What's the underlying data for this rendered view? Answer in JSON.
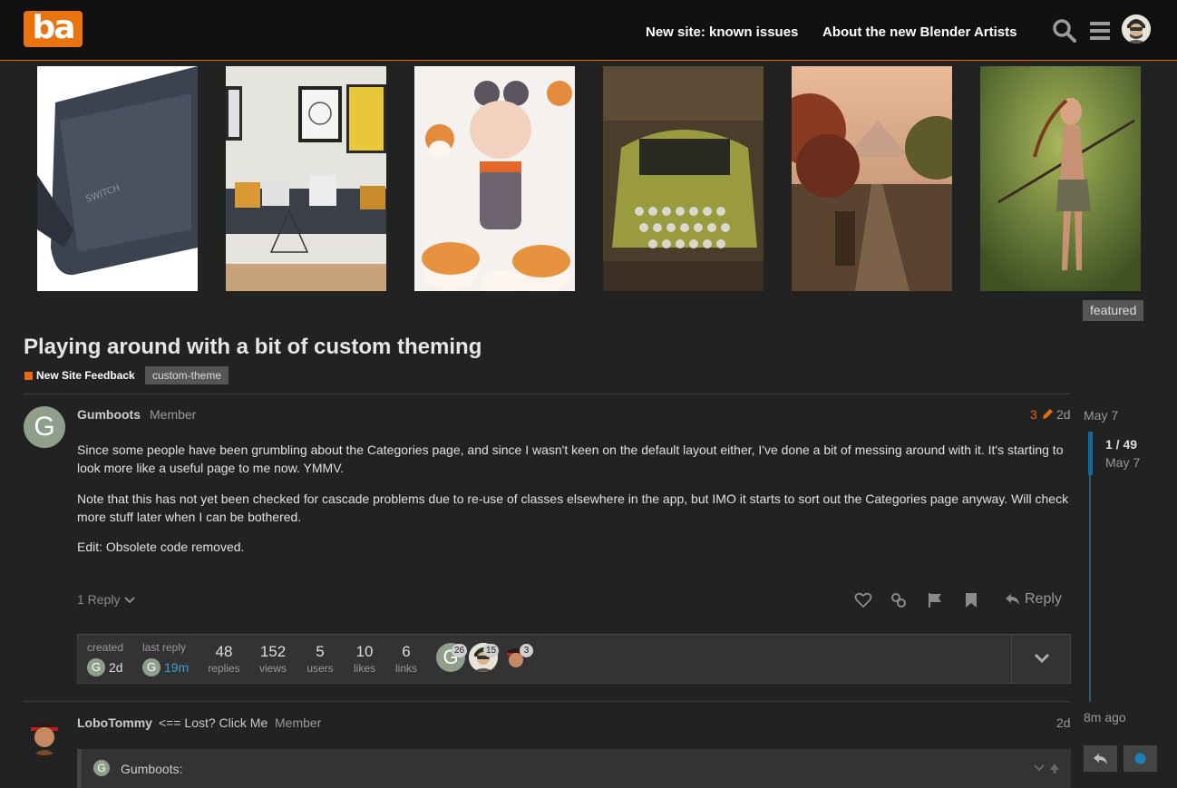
{
  "header": {
    "logo_text": "ba",
    "nav": [
      "New site: known issues",
      "About the new Blender Artists"
    ]
  },
  "featured": {
    "tag": "featured",
    "images": [
      {
        "icon": "console-image"
      },
      {
        "icon": "interior-image"
      },
      {
        "icon": "character-image"
      },
      {
        "icon": "typewriter-image"
      },
      {
        "icon": "landscape-image"
      },
      {
        "icon": "warrior-image"
      }
    ]
  },
  "topic": {
    "title": "Playing around with a bit of custom theming",
    "category": "New Site Feedback",
    "category_color": "#e86a12",
    "tag": "custom-theme"
  },
  "post": {
    "avatar_letter": "G",
    "username": "Gumboots",
    "role": "Member",
    "edit_count": "3",
    "age": "2d",
    "paragraphs": [
      "Since some people have been grumbling about the Categories page, and since I wasn't keen on the default layout either, I've done a bit of messing around with it. It's starting to look more like a useful page to me now. YMMV.",
      "Note that this has not yet been checked for cascade problems due to re-use of classes elsewhere in the app, but IMO it starts to sort out the Categories page anyway. Will check more stuff later when I can be bothered.",
      "Edit: Obsolete code removed."
    ],
    "replies_toggle": "1 Reply",
    "reply_label": "Reply"
  },
  "topic_map": {
    "created_label": "created",
    "created_value": "2d",
    "last_reply_label": "last reply",
    "last_reply_value": "19m",
    "stats": [
      {
        "value": "48",
        "label": "replies"
      },
      {
        "value": "152",
        "label": "views"
      },
      {
        "value": "5",
        "label": "users"
      },
      {
        "value": "10",
        "label": "likes"
      },
      {
        "value": "6",
        "label": "links"
      }
    ],
    "participants": [
      {
        "letter": "G",
        "count": "26"
      },
      {
        "count": "15"
      },
      {
        "count": "3"
      }
    ]
  },
  "timeline": {
    "top_date": "May 7",
    "position": "1 / 49",
    "position_date": "May 7",
    "bottom_date": "8m ago"
  },
  "post2": {
    "username": "LoboTommy",
    "title": "<== Lost? Click Me",
    "role": "Member",
    "age": "2d",
    "quote_author_letter": "G",
    "quote_author": "Gumboots:"
  }
}
